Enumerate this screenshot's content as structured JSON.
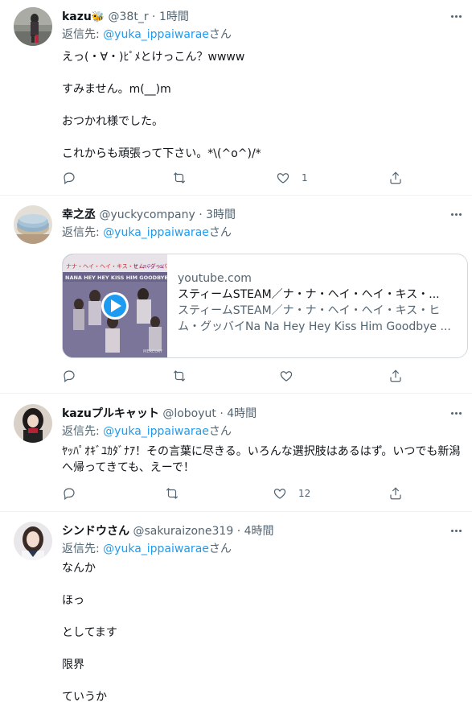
{
  "reply_prefix": "返信先: ",
  "reply_suffix": "さん",
  "tweets": [
    {
      "name": "kazu",
      "name_badge": "🐝",
      "handle": "@38t_r",
      "dot": "·",
      "time": "1時間",
      "reply_to": "@yuka_ippaiwarae",
      "paragraphs": [
        "えっ(・∀・)ﾋﾟﾒとけっこん？wwww",
        "すみません。m(__)m",
        "おつかれ様でした。",
        "これからも頑張って下さい。*\\(^o^)/*"
      ],
      "counts": {
        "reply": "",
        "retweet": "",
        "like": "1"
      }
    },
    {
      "name": "幸之丞",
      "handle": "@yuckycompany",
      "dot": "·",
      "time": "3時間",
      "reply_to": "@yuka_ippaiwarae",
      "card": {
        "thumb_banner": "ナナ・ヘイ・ヘイ・キス・ヒム・グッバイ",
        "thumb_band": "ザ・スティーム",
        "thumb_title": "NANA HEY HEY KISS HIM GOODBYE",
        "thumb_label": "MERCURY",
        "domain": "youtube.com",
        "title": "スティームSTEAM／ナ・ナ・ヘイ・ヘイ・キス・...",
        "description": "スティームSTEAM／ナ・ナ・ヘイ・ヘイ・キス・ヒム・グッバイNa Na Hey Hey Kiss Him Goodbye ..."
      },
      "counts": {
        "reply": "",
        "retweet": "",
        "like": ""
      }
    },
    {
      "name": "kazuプルキャット",
      "handle": "@loboyut",
      "dot": "·",
      "time": "4時間",
      "reply_to": "@yuka_ippaiwarae",
      "paragraphs": [
        "ﾔｯﾊﾟｵｷﾞﾕｶﾀﾞﾅｱ！その言葉に尽きる。いろんな選択肢はあるはず。いつでも新潟へ帰ってきても、えーで！"
      ],
      "counts": {
        "reply": "",
        "retweet": "",
        "like": "12"
      }
    },
    {
      "name": "シンドウさん",
      "handle": "@sakuraizone319",
      "dot": "·",
      "time": "4時間",
      "reply_to": "@yuka_ippaiwarae",
      "paragraphs": [
        "なんか",
        "ほっ",
        "としてます",
        "限界",
        "ていうか"
      ]
    }
  ],
  "colors": {
    "text": "#0f1419",
    "secondary": "#536471",
    "link": "#1d9bf0",
    "divider": "#eff3f4",
    "card_border": "#cfd9de"
  },
  "icons": [
    "more-icon",
    "reply-icon",
    "retweet-icon",
    "like-icon",
    "share-icon",
    "play-icon"
  ]
}
